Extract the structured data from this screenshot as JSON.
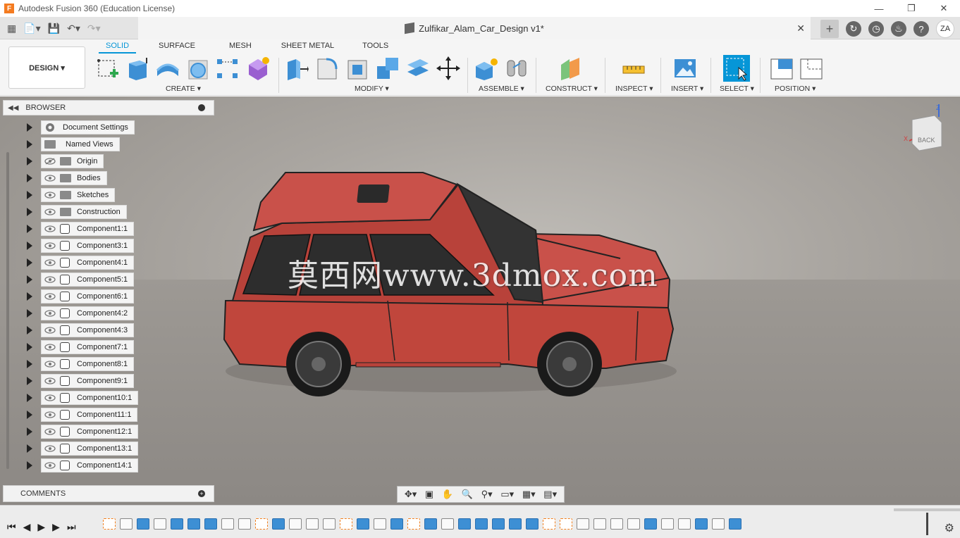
{
  "app": {
    "title": "Autodesk Fusion 360 (Education License)"
  },
  "document": {
    "name": "Zulfikar_Alam_Car_Design v1*"
  },
  "user": {
    "initials": "ZA"
  },
  "workspace": {
    "label": "DESIGN ▾"
  },
  "tabs": [
    "SOLID",
    "SURFACE",
    "MESH",
    "SHEET METAL",
    "TOOLS"
  ],
  "groups": {
    "create": "CREATE ▾",
    "modify": "MODIFY ▾",
    "assemble": "ASSEMBLE ▾",
    "construct": "CONSTRUCT ▾",
    "inspect": "INSPECT ▾",
    "insert": "INSERT ▾",
    "select": "SELECT ▾",
    "position": "POSITION ▾"
  },
  "browser": {
    "title": "BROWSER",
    "items": [
      "Document Settings",
      "Named Views",
      "Origin",
      "Bodies",
      "Sketches",
      "Construction",
      "Component1:1",
      "Component3:1",
      "Component4:1",
      "Component5:1",
      "Component6:1",
      "Component4:2",
      "Component4:3",
      "Component7:1",
      "Component8:1",
      "Component9:1",
      "Component10:1",
      "Component11:1",
      "Component12:1",
      "Component13:1",
      "Component14:1"
    ]
  },
  "comments": {
    "title": "COMMENTS"
  },
  "viewcube": {
    "face": "BACK",
    "axis_z": "Z",
    "axis_x": "X"
  },
  "watermark": "莫西网www.3dmox.com",
  "colors": {
    "accent": "#0696d7",
    "car_body": "#c0463c",
    "timeline_blue": "#3d8fd4"
  }
}
